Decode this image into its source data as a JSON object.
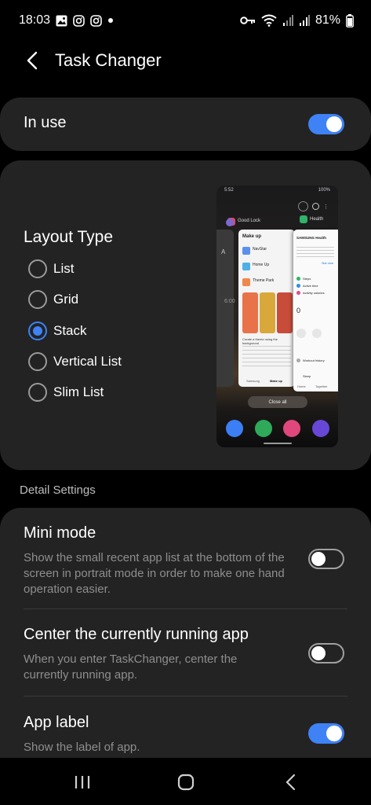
{
  "status_bar": {
    "time": "18:03",
    "battery": "81%",
    "left_icons": [
      "gallery-icon",
      "instagram-icon",
      "instagram-icon",
      "notification-dot-icon"
    ],
    "right_icons": [
      "key-icon",
      "wifi-icon",
      "signal-icon",
      "signal-icon"
    ]
  },
  "header": {
    "title": "Task Changer"
  },
  "in_use": {
    "label": "In use",
    "on": true
  },
  "layout": {
    "title": "Layout Type",
    "options": [
      "List",
      "Grid",
      "Stack",
      "Vertical List",
      "Slim List"
    ],
    "selected": "Stack"
  },
  "preview": {
    "time": "5:52",
    "status": "100%",
    "apps": [
      "Good Lock",
      "Health"
    ],
    "card_title": "Make up",
    "card_items": [
      "NavStar",
      "Home Up",
      "Theme Park"
    ],
    "card_caption": "Create a theme using the background",
    "card_tabs": [
      "Samsung",
      "Make up"
    ],
    "health_brand": "SAMSUNG Health",
    "health_button": "Not now",
    "health_items": [
      "Steps",
      "Active time",
      "Activity calories"
    ],
    "health_value": "0",
    "health_extra": [
      "Workout history",
      "Sleep"
    ],
    "health_tabs": [
      "Home",
      "Together"
    ],
    "side_label": "A",
    "side_time": "6:00",
    "close_all": "Close all"
  },
  "detail_settings": {
    "section_label": "Detail Settings",
    "items": [
      {
        "title": "Mini mode",
        "description": "Show the small recent app list at the bottom of the screen in portrait mode in order to make one hand operation easier.",
        "on": false
      },
      {
        "title": "Center the currently running app",
        "description": "When you enter TaskChanger, center the currently running app.",
        "on": false
      },
      {
        "title": "App label",
        "description": "Show the label of app.",
        "on": true
      }
    ]
  },
  "colors": {
    "accent": "#3e82f5",
    "card_background": "#232323",
    "background": "#000000",
    "secondary_text": "#8e8e8e"
  }
}
